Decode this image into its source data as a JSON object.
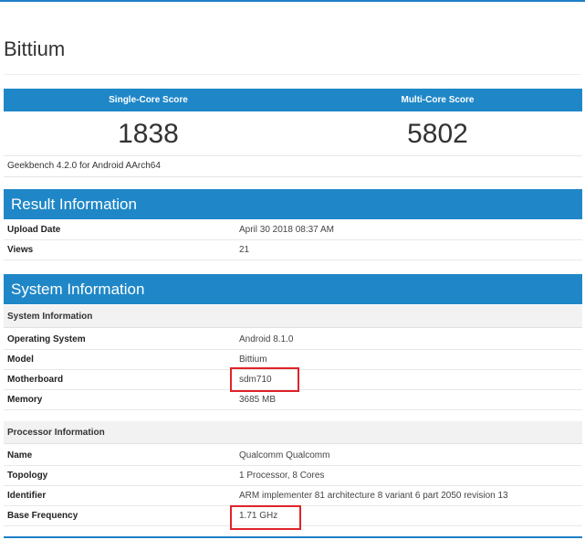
{
  "device": {
    "title": "Bittium"
  },
  "scores": {
    "single_label": "Single-Core Score",
    "multi_label": "Multi-Core Score",
    "single_value": "1838",
    "multi_value": "5802",
    "version": "Geekbench 4.2.0 for Android AArch64"
  },
  "result_info": {
    "header": "Result Information",
    "rows": [
      {
        "key": "Upload Date",
        "value": "April 30 2018 08:37 AM"
      },
      {
        "key": "Views",
        "value": "21"
      }
    ]
  },
  "system_info": {
    "header": "System Information",
    "system_sub": "System Information",
    "system_rows": [
      {
        "key": "Operating System",
        "value": "Android 8.1.0"
      },
      {
        "key": "Model",
        "value": "Bittium"
      },
      {
        "key": "Motherboard",
        "value": "sdm710"
      },
      {
        "key": "Memory",
        "value": "3685 MB"
      }
    ],
    "processor_sub": "Processor Information",
    "processor_rows": [
      {
        "key": "Name",
        "value": "Qualcomm Qualcomm"
      },
      {
        "key": "Topology",
        "value": "1 Processor, 8 Cores"
      },
      {
        "key": "Identifier",
        "value": "ARM implementer 81 architecture 8 variant 6 part 2050 revision 13"
      },
      {
        "key": "Base Frequency",
        "value": "1.71 GHz"
      }
    ]
  },
  "colors": {
    "header_blue": "#1f87c7",
    "highlight_red": "#e0232a"
  }
}
